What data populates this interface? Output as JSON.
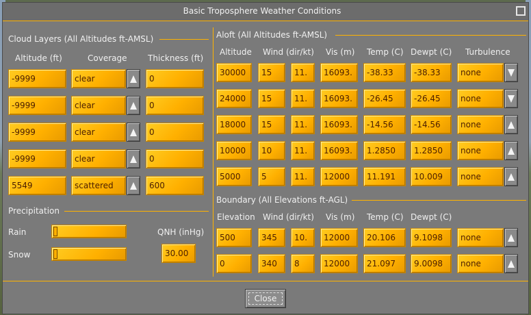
{
  "window": {
    "title": "Basic Troposphere Weather Conditions"
  },
  "cloud": {
    "section": "Cloud Layers (All Altitudes ft-AMSL)",
    "headers": {
      "altitude": "Altitude (ft)",
      "coverage": "Coverage",
      "thickness": "Thickness (ft)"
    },
    "rows": [
      {
        "altitude": "-9999",
        "coverage": "clear",
        "thickness": "0"
      },
      {
        "altitude": "-9999",
        "coverage": "clear",
        "thickness": "0"
      },
      {
        "altitude": "-9999",
        "coverage": "clear",
        "thickness": "0"
      },
      {
        "altitude": "-9999",
        "coverage": "clear",
        "thickness": "0"
      },
      {
        "altitude": "5549",
        "coverage": "scattered",
        "thickness": "600"
      }
    ]
  },
  "precip": {
    "section": "Precipitation",
    "rain_label": "Rain",
    "snow_label": "Snow",
    "rain_level": 0.0,
    "snow_level": 0.0,
    "qnh_label": "QNH (inHg)",
    "qnh_value": "30.00"
  },
  "aloft": {
    "section": "Aloft (All Altitudes ft-AMSL)",
    "headers": {
      "altitude": "Altitude",
      "wind": "Wind (dir/kt)",
      "vis": "Vis (m)",
      "temp": "Temp (C)",
      "dewpt": "Dewpt (C)",
      "turb": "Turbulence"
    },
    "rows": [
      {
        "alt": "30000",
        "dir": "15",
        "kt": "11.",
        "vis": "16093.",
        "temp": "-38.33",
        "dewpt": "-38.33",
        "turb": "none",
        "arrow": "down"
      },
      {
        "alt": "24000",
        "dir": "15",
        "kt": "11.",
        "vis": "16093.",
        "temp": "-26.45",
        "dewpt": "-26.45",
        "turb": "none",
        "arrow": "down"
      },
      {
        "alt": "18000",
        "dir": "15",
        "kt": "11.",
        "vis": "16093.",
        "temp": "-14.56",
        "dewpt": "-14.56",
        "turb": "none",
        "arrow": "up"
      },
      {
        "alt": "10000",
        "dir": "10",
        "kt": "11.",
        "vis": "16093.",
        "temp": "1.2850",
        "dewpt": "1.2850",
        "turb": "none",
        "arrow": "up"
      },
      {
        "alt": "5000",
        "dir": "5",
        "kt": "11.",
        "vis": "12000",
        "temp": "11.191",
        "dewpt": "10.009",
        "turb": "none",
        "arrow": "up"
      }
    ]
  },
  "boundary": {
    "section": "Boundary (All Elevations ft-AGL)",
    "headers": {
      "elevation": "Elevation",
      "wind": "Wind (dir/kt)",
      "vis": "Vis (m)",
      "temp": "Temp (C)",
      "dewpt": "Dewpt (C)"
    },
    "rows": [
      {
        "elev": "500",
        "dir": "345",
        "kt": "10.",
        "vis": "12000",
        "temp": "20.106",
        "dewpt": "9.1098",
        "turb": "none",
        "arrow": "up"
      },
      {
        "elev": "0",
        "dir": "340",
        "kt": "8",
        "vis": "12000",
        "temp": "21.097",
        "dewpt": "9.0098",
        "turb": "none",
        "arrow": "up"
      }
    ]
  },
  "footer": {
    "close_label": "Close"
  },
  "colors": {
    "field": "#ffb000",
    "panel": "#7a7a7a",
    "accent_line": "#ffb300",
    "field_text": "#4a1e00"
  }
}
